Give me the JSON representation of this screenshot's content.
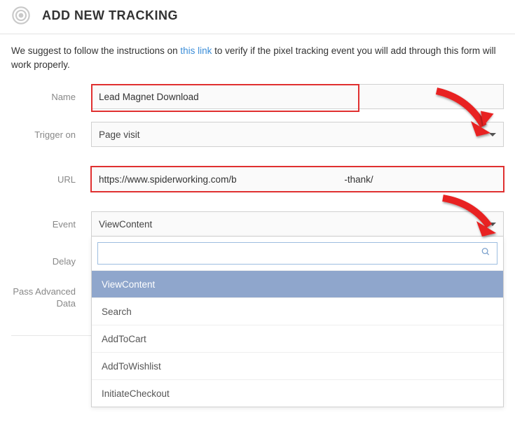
{
  "header": {
    "title": "ADD NEW TRACKING"
  },
  "intro": {
    "text_before": "We suggest to follow the instructions on ",
    "link_text": "this link",
    "text_after": " to verify if the pixel tracking event you will add through this form will work properly."
  },
  "form": {
    "name": {
      "label": "Name",
      "value": "Lead Magnet Download"
    },
    "trigger": {
      "label": "Trigger on",
      "value": "Page visit"
    },
    "url": {
      "label": "URL",
      "value": "https://www.spiderworking.com/b                                         -thank/"
    },
    "event": {
      "label": "Event",
      "value": "ViewContent",
      "options": [
        "ViewContent",
        "Search",
        "AddToCart",
        "AddToWishlist",
        "InitiateCheckout"
      ],
      "search_placeholder": ""
    },
    "delay": {
      "label": "Delay"
    },
    "pass_advanced": {
      "label": "Pass Advanced Data"
    }
  }
}
